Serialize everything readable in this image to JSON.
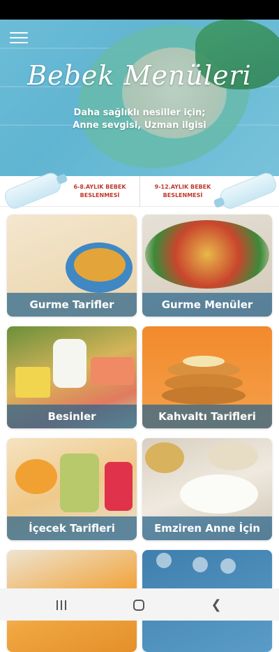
{
  "app": {
    "title": "Bebek Menüleri",
    "subtitle_line1": "Daha sağlıklı nesiller için;",
    "subtitle_line2": "Anne sevgisi, Uzman ilgisi"
  },
  "tabs": [
    {
      "label": "6-8.AYLIK BEBEK BESLENMESİ"
    },
    {
      "label": "9-12.AYLIK BEBEK BESLENMESİ"
    }
  ],
  "cards": [
    {
      "label": "Gurme Tarifler"
    },
    {
      "label": "Gurme Menüler"
    },
    {
      "label": "Besinler"
    },
    {
      "label": "Kahvaltı Tarifleri"
    },
    {
      "label": "İçecek Tarifleri"
    },
    {
      "label": "Emziren Anne İçin"
    }
  ],
  "icons": {
    "menu": "hamburger-menu-icon",
    "recents": "recents-icon",
    "home": "home-icon",
    "back": "back-icon"
  },
  "colors": {
    "tab_text": "#c0392b",
    "card_label_bg": "#28648c",
    "hero_bg": "#7ecbe2"
  }
}
